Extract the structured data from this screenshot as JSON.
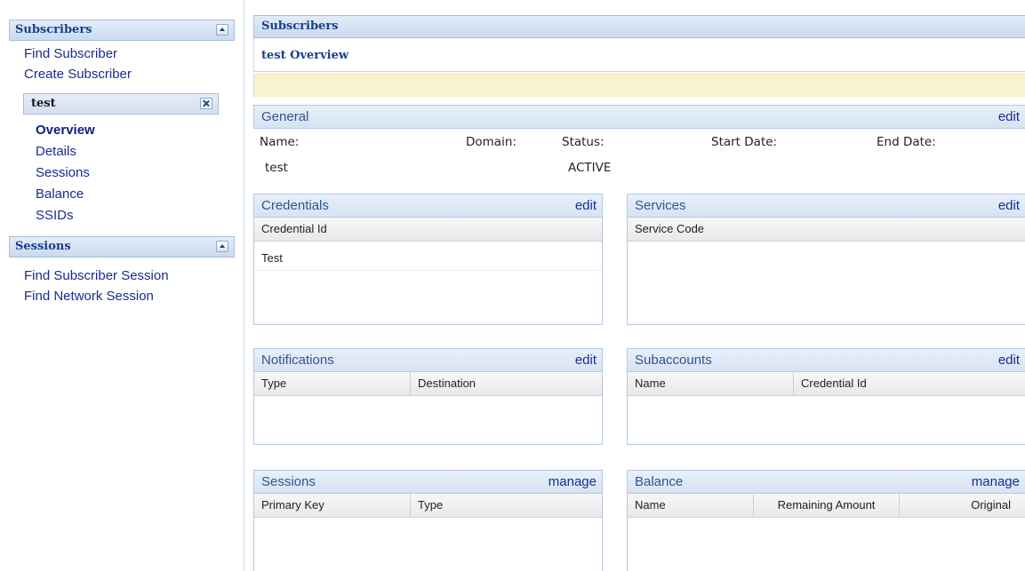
{
  "sidebar": {
    "subscribers_panel": {
      "title": "Subscribers",
      "links": [
        "Find Subscriber",
        "Create Subscriber"
      ]
    },
    "current_subscriber": {
      "name": "test",
      "nav": [
        "Overview",
        "Details",
        "Sessions",
        "Balance",
        "SSIDs"
      ],
      "active": "Overview"
    },
    "sessions_panel": {
      "title": "Sessions",
      "links": [
        "Find Subscriber Session",
        "Find Network Session"
      ]
    }
  },
  "main": {
    "header_title": "Subscribers",
    "overview_title": "test Overview",
    "general": {
      "title": "General",
      "action": "edit",
      "labels": {
        "name": "Name:",
        "domain": "Domain:",
        "status": "Status:",
        "start_date": "Start Date:",
        "end_date": "End Date:"
      },
      "values": {
        "name": "test",
        "domain": "",
        "status": "ACTIVE",
        "start_date": "",
        "end_date": ""
      }
    },
    "credentials": {
      "title": "Credentials",
      "action": "edit",
      "columns": [
        "Credential Id"
      ],
      "rows": [
        [
          "Test"
        ]
      ]
    },
    "services": {
      "title": "Services",
      "action": "edit",
      "columns": [
        "Service Code"
      ],
      "rows": []
    },
    "notifications": {
      "title": "Notifications",
      "action": "edit",
      "columns": [
        "Type",
        "Destination"
      ],
      "rows": []
    },
    "subaccounts": {
      "title": "Subaccounts",
      "action": "edit",
      "columns": [
        "Name",
        "Credential Id"
      ],
      "rows": []
    },
    "sessions": {
      "title": "Sessions",
      "action": "manage",
      "columns": [
        "Primary Key",
        "Type"
      ],
      "rows": []
    },
    "balance": {
      "title": "Balance",
      "action": "manage",
      "columns": [
        "Name",
        "Remaining Amount",
        "Original"
      ],
      "rows": []
    }
  }
}
